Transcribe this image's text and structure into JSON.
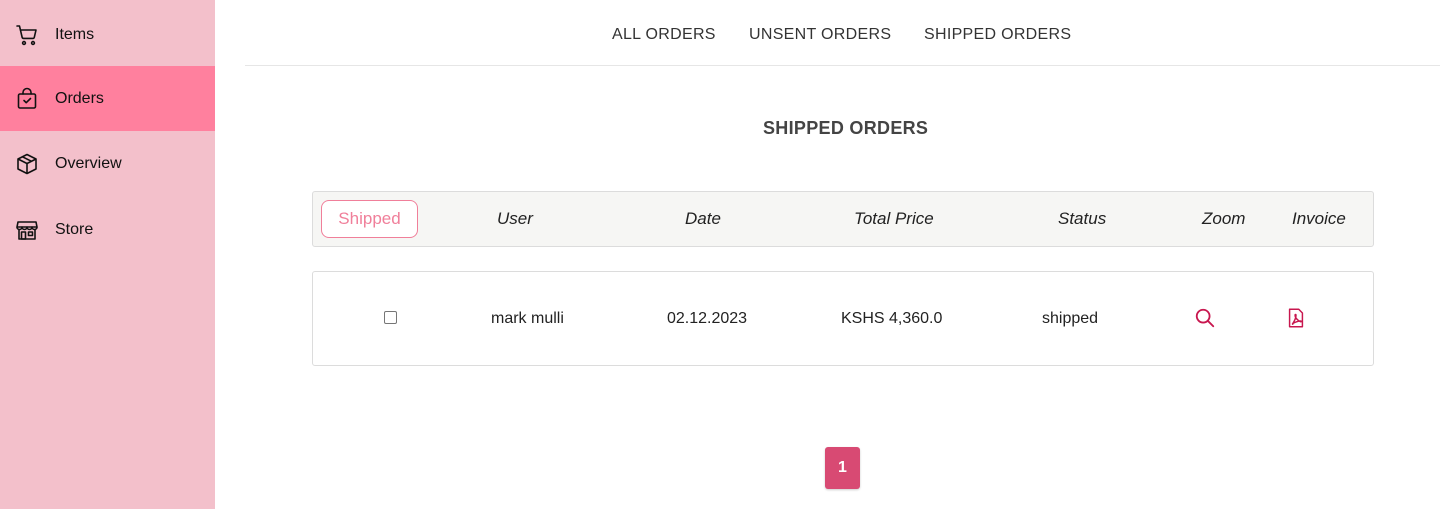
{
  "sidebar": {
    "items": [
      {
        "label": "Items",
        "icon": "cart-icon"
      },
      {
        "label": "Orders",
        "icon": "shopping-bag-check-icon",
        "active": true
      },
      {
        "label": "Overview",
        "icon": "box-icon"
      },
      {
        "label": "Store",
        "icon": "storefront-icon"
      }
    ],
    "background": "#f3c0cb",
    "active_background": "#ff809e"
  },
  "tabs": [
    "ALL ORDERS",
    "UNSENT ORDERS",
    "SHIPPED ORDERS"
  ],
  "section_title": "SHIPPED ORDERS",
  "table": {
    "filter_label": "Shipped",
    "columns": [
      "User",
      "Date",
      "Total Price",
      "Status",
      "Zoom",
      "Invoice"
    ],
    "rows": [
      {
        "user": "mark mulli",
        "date": "02.12.2023",
        "total_price": "KSHS 4,360.0",
        "status": "shipped",
        "zoom_icon": "magnifier-icon",
        "invoice_icon": "pdf-icon"
      }
    ]
  },
  "pagination": {
    "current_page": "1"
  },
  "colors": {
    "accent": "#d84a73",
    "icon_accent": "#c8174f",
    "filter_border": "#f07f9a"
  }
}
